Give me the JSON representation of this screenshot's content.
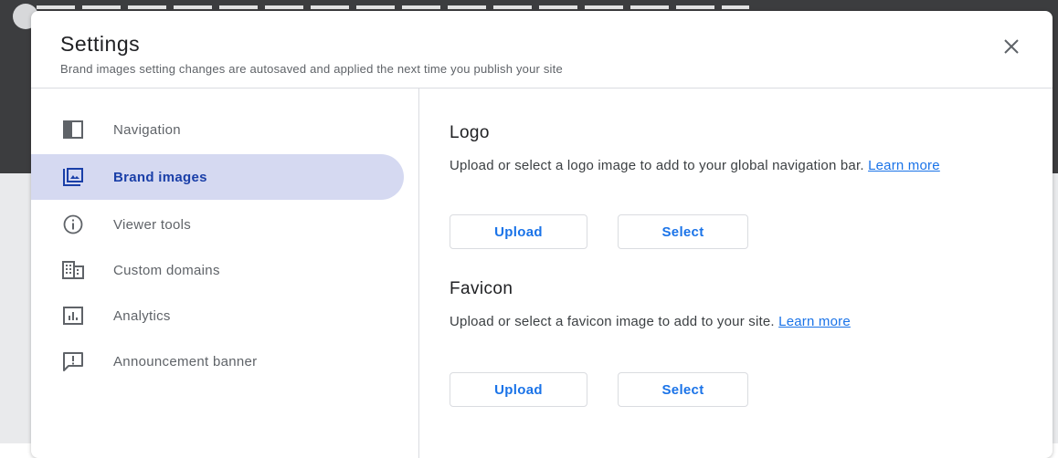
{
  "dialog": {
    "title": "Settings",
    "subtitle": "Brand images setting changes are autosaved and applied the next time you publish your site",
    "close_icon": "close-icon"
  },
  "sidebar": {
    "active_color": "#d5d9f1",
    "items": [
      {
        "label": "Navigation",
        "icon": "navigation-icon",
        "active": false
      },
      {
        "label": "Brand images",
        "icon": "image-icon",
        "active": true
      },
      {
        "label": "Viewer tools",
        "icon": "info-icon",
        "active": false
      },
      {
        "label": "Custom domains",
        "icon": "domain-icon",
        "active": false
      },
      {
        "label": "Analytics",
        "icon": "analytics-icon",
        "active": false
      },
      {
        "label": "Announcement banner",
        "icon": "announcement-icon",
        "active": false
      }
    ]
  },
  "logo": {
    "title": "Logo",
    "desc": "Upload or select a logo image to add to your global navigation bar.",
    "link": "Learn more",
    "upload_label": "Upload",
    "select_label": "Select"
  },
  "favicon": {
    "title": "Favicon",
    "desc": "Upload or select a favicon image to add to your site.",
    "link": "Learn more",
    "upload_label": "Upload",
    "select_label": "Select"
  },
  "colors": {
    "accent": "#1a73e8",
    "active_text": "#1a3fa8"
  }
}
